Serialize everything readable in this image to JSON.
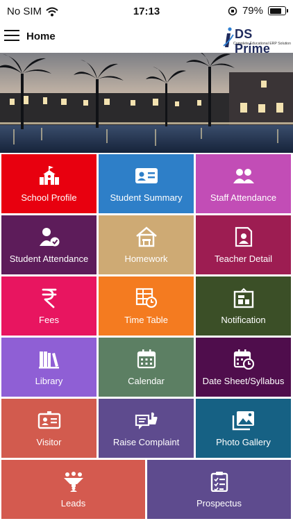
{
  "status_bar": {
    "carrier": "No SIM",
    "time": "17:13",
    "battery_percent": "79%",
    "battery_level": 0.79
  },
  "header": {
    "title": "Home",
    "logo_brand": "DS Prime",
    "logo_tagline": "Complete Educational ERP Solution"
  },
  "colors": {
    "logo_navy": "#1f2a5c",
    "logo_blue": "#2f7fd1"
  },
  "tiles": [
    {
      "label": "School Profile",
      "icon": "school-building-icon",
      "color": "#e8000f"
    },
    {
      "label": "Student Summary",
      "icon": "id-card-icon",
      "color": "#2e7fc8"
    },
    {
      "label": "Staff Attendance",
      "icon": "people-group-icon",
      "color": "#c24db6"
    },
    {
      "label": "Student Attendance",
      "icon": "user-check-icon",
      "color": "#5d1c5a"
    },
    {
      "label": "Homework",
      "icon": "house-desk-icon",
      "color": "#ceaa74"
    },
    {
      "label": "Teacher Detail",
      "icon": "teacher-profile-icon",
      "color": "#9d1d52"
    },
    {
      "label": "Fees",
      "icon": "rupee-icon",
      "color": "#e81560"
    },
    {
      "label": "Time Table",
      "icon": "timetable-clock-icon",
      "color": "#f47b20"
    },
    {
      "label": "Notification",
      "icon": "notice-board-icon",
      "color": "#3b4f27"
    },
    {
      "label": "Library",
      "icon": "books-icon",
      "color": "#8f5fd5"
    },
    {
      "label": "Calendar",
      "icon": "calendar-icon",
      "color": "#5c7f63"
    },
    {
      "label": "Date Sheet/Syllabus",
      "icon": "calendar-clock-icon",
      "color": "#4f0d4c"
    },
    {
      "label": "Visitor",
      "icon": "visitor-badge-icon",
      "color": "#d25b4e"
    },
    {
      "label": "Raise Complaint",
      "icon": "complaint-icon",
      "color": "#5e4b8e"
    },
    {
      "label": "Photo Gallery",
      "icon": "photo-gallery-icon",
      "color": "#166184"
    },
    {
      "label": "Leads",
      "icon": "funnel-people-icon",
      "color": "#d45a4f"
    },
    {
      "label": "Prospectus",
      "icon": "checklist-icon",
      "color": "#5e4b8e"
    }
  ]
}
